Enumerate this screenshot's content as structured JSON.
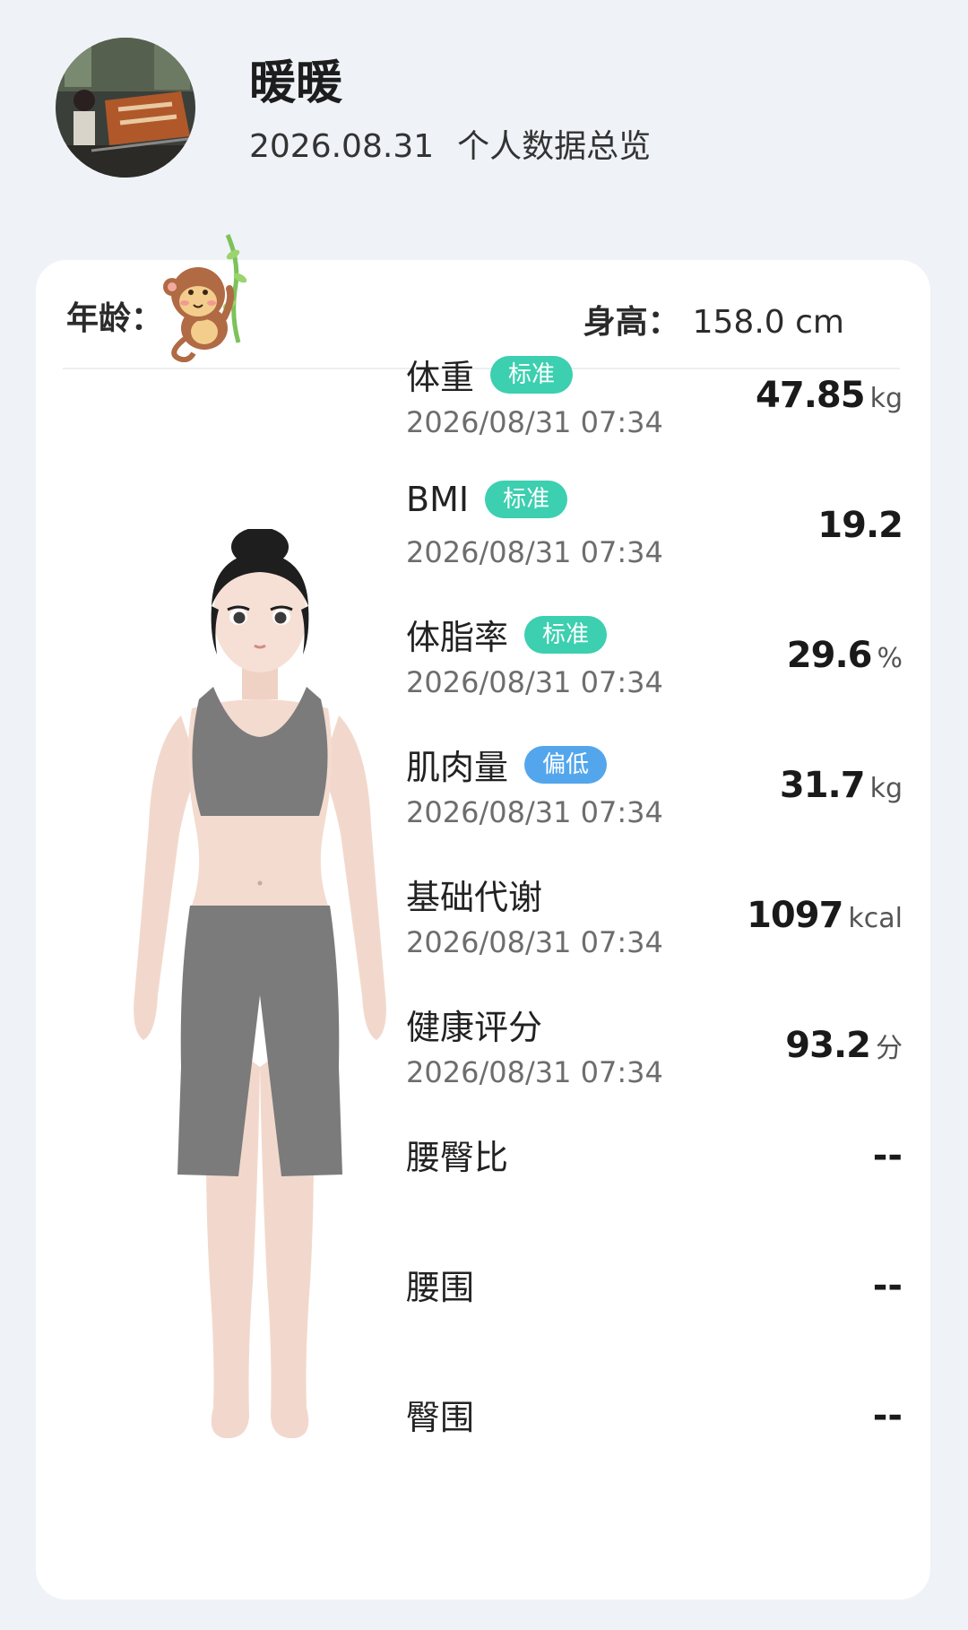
{
  "header": {
    "username": "暖暖",
    "date": "2026.08.31",
    "subtitle": "个人数据总览"
  },
  "profile": {
    "age_label": "年龄：",
    "height_label": "身高：",
    "height_value": "158.0 cm"
  },
  "metrics": [
    {
      "name": "体重",
      "badge": "标准",
      "badge_color": "#3ccfb0",
      "time": "2026/08/31 07:34",
      "value": "47.85",
      "unit": "kg"
    },
    {
      "name": "BMI",
      "badge": "标准",
      "badge_color": "#3ccfb0",
      "time": "2026/08/31 07:34",
      "value": "19.2",
      "unit": ""
    },
    {
      "name": "体脂率",
      "badge": "标准",
      "badge_color": "#3ccfb0",
      "time": "2026/08/31 07:34",
      "value": "29.6",
      "unit": "%"
    },
    {
      "name": "肌肉量",
      "badge": "偏低",
      "badge_color": "#53a6ec",
      "time": "2026/08/31 07:34",
      "value": "31.7",
      "unit": "kg"
    },
    {
      "name": "基础代谢",
      "time": "2026/08/31 07:34",
      "value": "1097",
      "unit": "kcal"
    },
    {
      "name": "健康评分",
      "time": "2026/08/31 07:34",
      "value": "93.2",
      "unit": "分"
    },
    {
      "name": "腰臀比",
      "value": "--"
    },
    {
      "name": "腰围",
      "value": "--"
    },
    {
      "name": "臀围",
      "value": "--"
    }
  ],
  "icons": {
    "avatar": "user-avatar-photo",
    "monkey": "monkey-sticker-icon",
    "figure": "body-model-figure"
  },
  "colors": {
    "background": "#eff2f7",
    "card": "#ffffff",
    "badge_standard": "#3ccfb0",
    "badge_low": "#53a6ec"
  }
}
